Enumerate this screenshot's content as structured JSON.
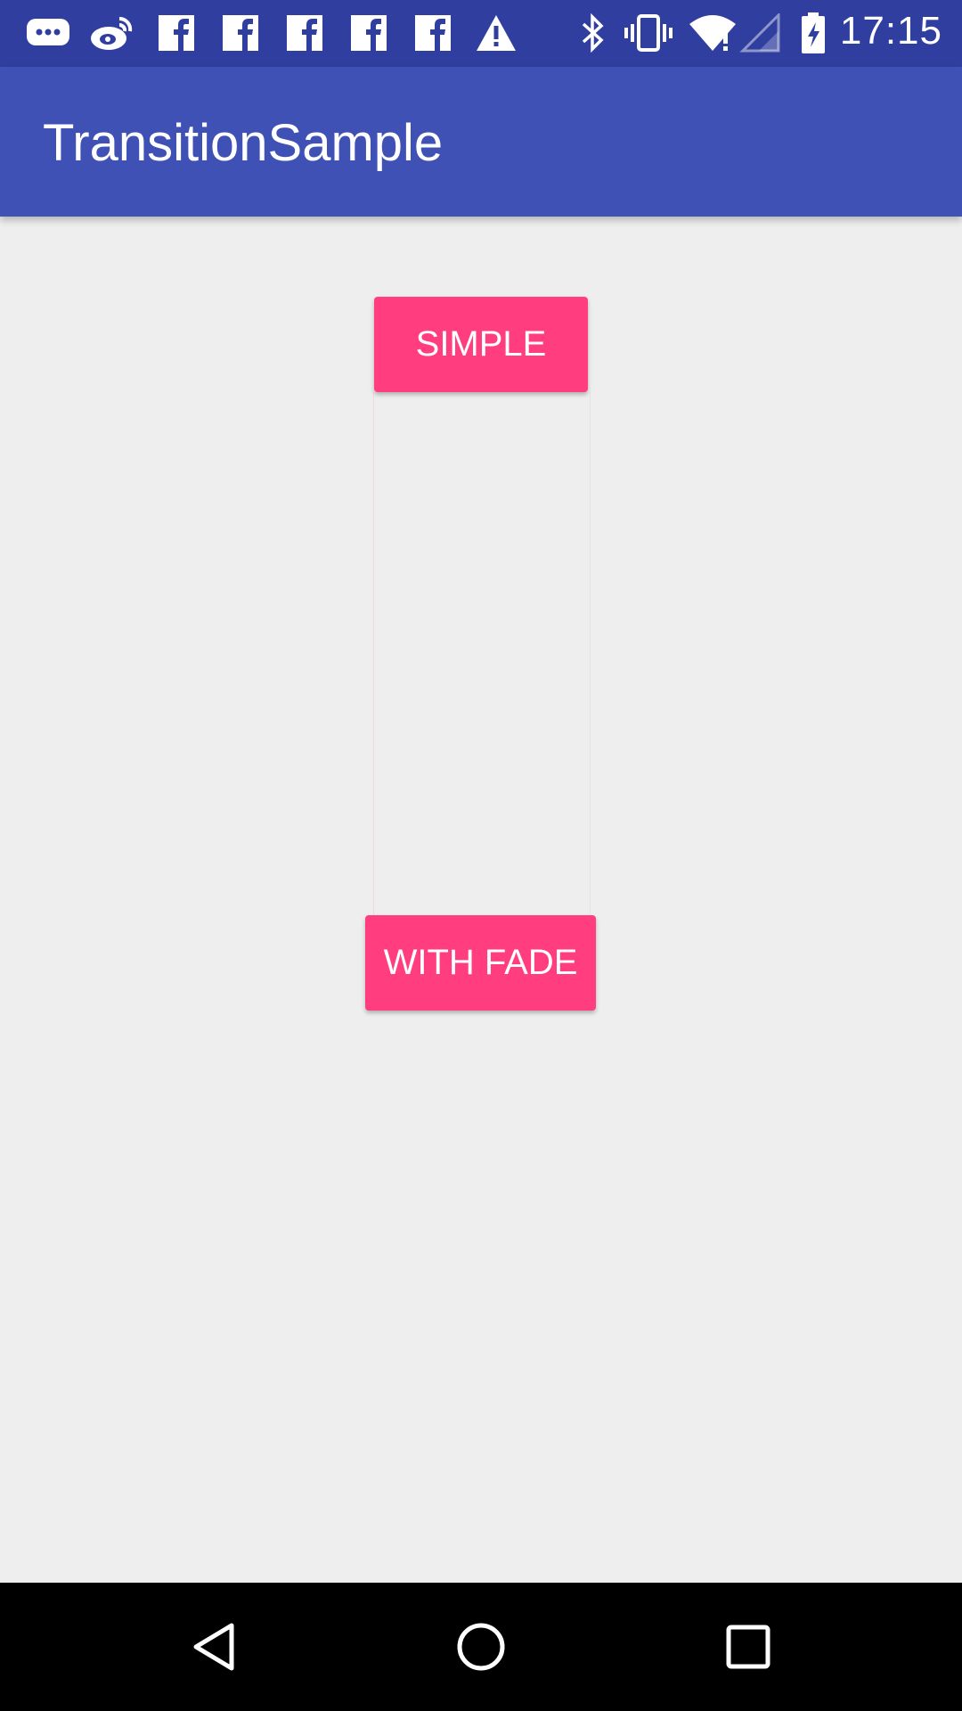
{
  "status_bar": {
    "time": "17:15",
    "icons": [
      "message-icon",
      "weibo-icon",
      "facebook-icon",
      "facebook-icon",
      "facebook-icon",
      "facebook-icon",
      "facebook-icon",
      "warning-icon",
      "bluetooth-icon",
      "vibrate-icon",
      "wifi-icon",
      "signal-icon",
      "battery-charging-icon"
    ]
  },
  "app_bar": {
    "title": "TransitionSample"
  },
  "buttons": {
    "simple": "SIMPLE",
    "with_fade": "WITH FADE"
  },
  "nav_bar": {
    "icons": [
      "back-icon",
      "home-icon",
      "recents-icon"
    ]
  },
  "colors": {
    "status_bar": "#303f9f",
    "app_bar": "#3f51b5",
    "accent": "#ff3d7f",
    "background": "#eeeeee"
  }
}
